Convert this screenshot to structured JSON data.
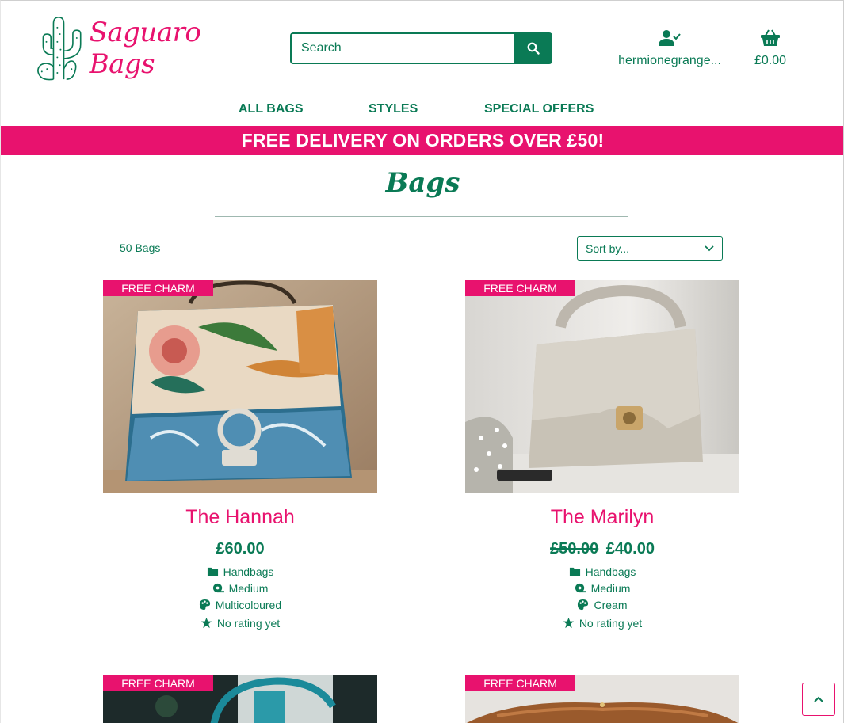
{
  "brand": {
    "name": "Saguaro Bags",
    "accent": "#e8126e",
    "primary": "#0a7a55"
  },
  "search": {
    "placeholder": "Search",
    "button_icon": "search-icon"
  },
  "account": {
    "label": "hermionegrange...",
    "icon": "user-check-icon"
  },
  "cart": {
    "total": "£0.00",
    "icon": "basket-icon"
  },
  "nav": {
    "items": [
      "ALL BAGS",
      "STYLES",
      "SPECIAL OFFERS"
    ]
  },
  "banner": {
    "text": "FREE DELIVERY ON ORDERS OVER £50!"
  },
  "page": {
    "title": "Bags",
    "count": "50 Bags",
    "sort_label": "Sort by..."
  },
  "products": [
    {
      "badge": "FREE CHARM",
      "name": "The Hannah",
      "price": "£60.00",
      "old_price": "",
      "category": "Handbags",
      "size": "Medium",
      "colour": "Multicoloured",
      "rating": "No rating yet"
    },
    {
      "badge": "FREE CHARM",
      "name": "The Marilyn",
      "price": "£40.00",
      "old_price": "£50.00",
      "category": "Handbags",
      "size": "Medium",
      "colour": "Cream",
      "rating": "No rating yet"
    },
    {
      "badge": "FREE CHARM"
    },
    {
      "badge": "FREE CHARM"
    }
  ]
}
